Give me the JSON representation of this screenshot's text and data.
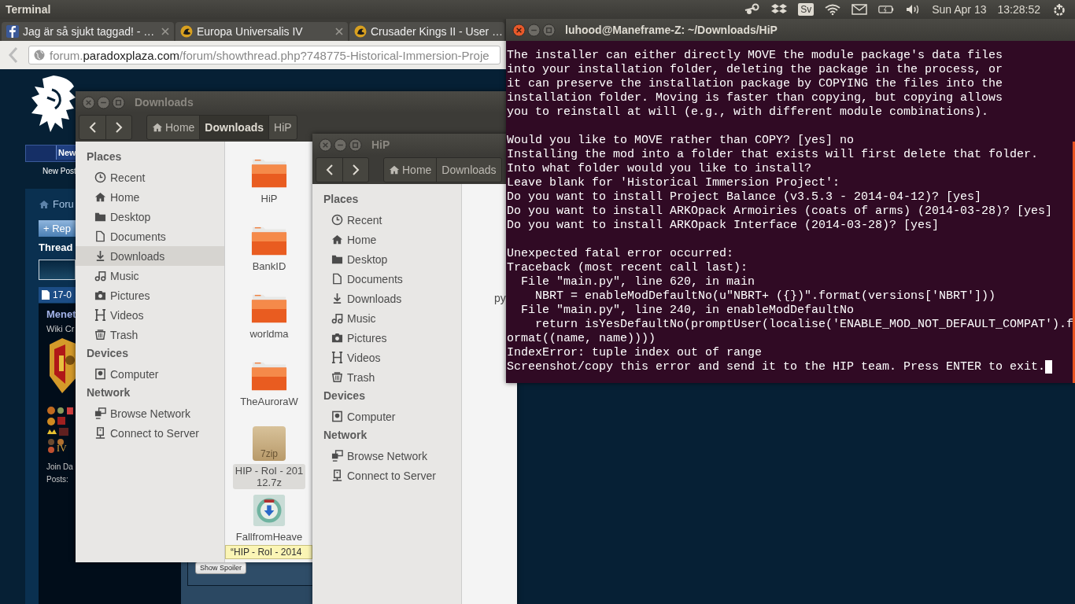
{
  "top_panel": {
    "title": "Terminal",
    "keyboard_layout": "Sv",
    "date": "Sun Apr 13",
    "time": "13:28:52"
  },
  "browser": {
    "tabs": [
      {
        "label": "Jag är så sjukt taggad! - …",
        "kind": "facebook",
        "selected": false,
        "closable": true
      },
      {
        "label": "Europa Universalis IV",
        "kind": "paradox",
        "selected": false,
        "closable": true
      },
      {
        "label": "Crusader Kings II - User …",
        "kind": "paradox",
        "selected": false
      }
    ],
    "address": {
      "prefix": "forum.",
      "domain": "paradoxplaza.com",
      "path": "/forum/showthread.php?748775-Historical-Immersion-Proje"
    },
    "page": {
      "nav_button": "New",
      "nav_link": "New Post",
      "breadcrumb": "Foru",
      "reply_button": "+ Rep",
      "section_title": "Thread",
      "post_date": "17-0",
      "author": "Menet",
      "author_title": "Wiki Cr",
      "badge_text": "IV",
      "join_date": "Join Da",
      "posts": "Posts:",
      "spoiler_button": "Show Spoiler"
    }
  },
  "downloads_window": {
    "title": "Downloads",
    "active": false,
    "breadcrumbs": [
      {
        "label": "Home",
        "kind": "home",
        "selected": false
      },
      {
        "label": "Downloads",
        "kind": "folder",
        "selected": true
      },
      {
        "label": "HiP",
        "kind": "folder",
        "selected": false
      }
    ],
    "sidebar": [
      {
        "heading": "Places",
        "items": [
          {
            "label": "Recent",
            "kind": "recent",
            "selected": false
          },
          {
            "label": "Home",
            "kind": "home",
            "selected": false
          },
          {
            "label": "Desktop",
            "kind": "desktop",
            "selected": false
          },
          {
            "label": "Documents",
            "kind": "documents",
            "selected": false
          },
          {
            "label": "Downloads",
            "kind": "downloads",
            "selected": true
          },
          {
            "label": "Music",
            "kind": "music",
            "selected": false
          },
          {
            "label": "Pictures",
            "kind": "pictures",
            "selected": false
          },
          {
            "label": "Videos",
            "kind": "videos",
            "selected": false
          },
          {
            "label": "Trash",
            "kind": "trash",
            "selected": false
          }
        ]
      },
      {
        "heading": "Devices",
        "items": [
          {
            "label": "Computer",
            "kind": "computer",
            "selected": false
          }
        ]
      },
      {
        "heading": "Network",
        "items": [
          {
            "label": "Browse Network",
            "kind": "network",
            "selected": false
          },
          {
            "label": "Connect to Server",
            "kind": "server",
            "selected": false
          }
        ]
      }
    ],
    "files": [
      {
        "name": "HiP",
        "kind": "folder",
        "selected": false
      },
      {
        "name": "BankID",
        "kind": "folder",
        "selected": false
      },
      {
        "name": "worldma",
        "kind": "folder",
        "selected": false
      },
      {
        "name": "TheAuroraW",
        "kind": "folder",
        "selected": false
      },
      {
        "name": "HIP - RoI - 201",
        "name_line_2": "12.7z",
        "kind": "archive",
        "badge": "7zip",
        "selected": true
      },
      {
        "name": "FallfromHeave",
        "kind": "installer",
        "selected": false
      }
    ],
    "tooltip": "“HIP - RoI - 2014"
  },
  "hip_window": {
    "title": "HiP",
    "active": false,
    "breadcrumbs": [
      {
        "label": "Home",
        "kind": "home",
        "selected": false
      },
      {
        "label": "Downloads",
        "kind": "folder",
        "selected": false
      }
    ],
    "sidebar": [
      {
        "heading": "Places",
        "items": [
          {
            "label": "Recent",
            "kind": "recent",
            "selected": false
          },
          {
            "label": "Home",
            "kind": "home",
            "selected": false
          },
          {
            "label": "Desktop",
            "kind": "desktop",
            "selected": false
          },
          {
            "label": "Documents",
            "kind": "documents",
            "selected": false
          },
          {
            "label": "Downloads",
            "kind": "downloads",
            "selected": false
          },
          {
            "label": "Music",
            "kind": "music",
            "selected": false
          },
          {
            "label": "Pictures",
            "kind": "pictures",
            "selected": false
          },
          {
            "label": "Videos",
            "kind": "videos",
            "selected": false
          },
          {
            "label": "Trash",
            "kind": "trash",
            "selected": false
          }
        ]
      },
      {
        "heading": "Devices",
        "items": [
          {
            "label": "Computer",
            "kind": "computer",
            "selected": false
          }
        ]
      },
      {
        "heading": "Network",
        "items": [
          {
            "label": "Browse Network",
            "kind": "network",
            "selected": false
          },
          {
            "label": "Connect to Server",
            "kind": "server",
            "selected": false
          }
        ]
      }
    ],
    "files": [
      {
        "name": "py"
      }
    ]
  },
  "terminal": {
    "title": "luhood@Maneframe-Z: ~/Downloads/HiP",
    "active": true,
    "cursor_visible": true,
    "blocks": [
      [
        "The installer can either directly MOVE the module package's data files",
        "into your installation folder, deleting the package in the process, or",
        "it can preserve the installation package by COPYING the files into the",
        "installation folder. Moving is faster than copying, but copying allows",
        "you to reinstall at will (e.g., with different module combinations)."
      ],
      [
        "Would you like to MOVE rather than COPY? [yes] no",
        "Installing the mod into a folder that exists will first delete that folder.",
        "Into what folder would you like to install?",
        "Leave blank for 'Historical Immersion Project':",
        "Do you want to install Project Balance (v3.5.3 - 2014-04-12)? [yes]",
        "Do you want to install ARKOpack Armoiries (coats of arms) (2014-03-28)? [yes]",
        "Do you want to install ARKOpack Interface (2014-03-28)? [yes]"
      ],
      [
        "Unexpected fatal error occurred:",
        "Traceback (most recent call last):",
        "  File \"main.py\", line 620, in main",
        "    NBRT = enableModDefaultNo(u\"NBRT+ ({})\".format(versions['NBRT']))",
        "  File \"main.py\", line 240, in enableModDefaultNo",
        "    return isYesDefaultNo(promptUser(localise('ENABLE_MOD_NOT_DEFAULT_COMPAT').f",
        "ormat((name, name))))",
        "IndexError: tuple index out of range",
        "Screenshot/copy this error and send it to the HIP team. Press ENTER to exit."
      ]
    ]
  }
}
